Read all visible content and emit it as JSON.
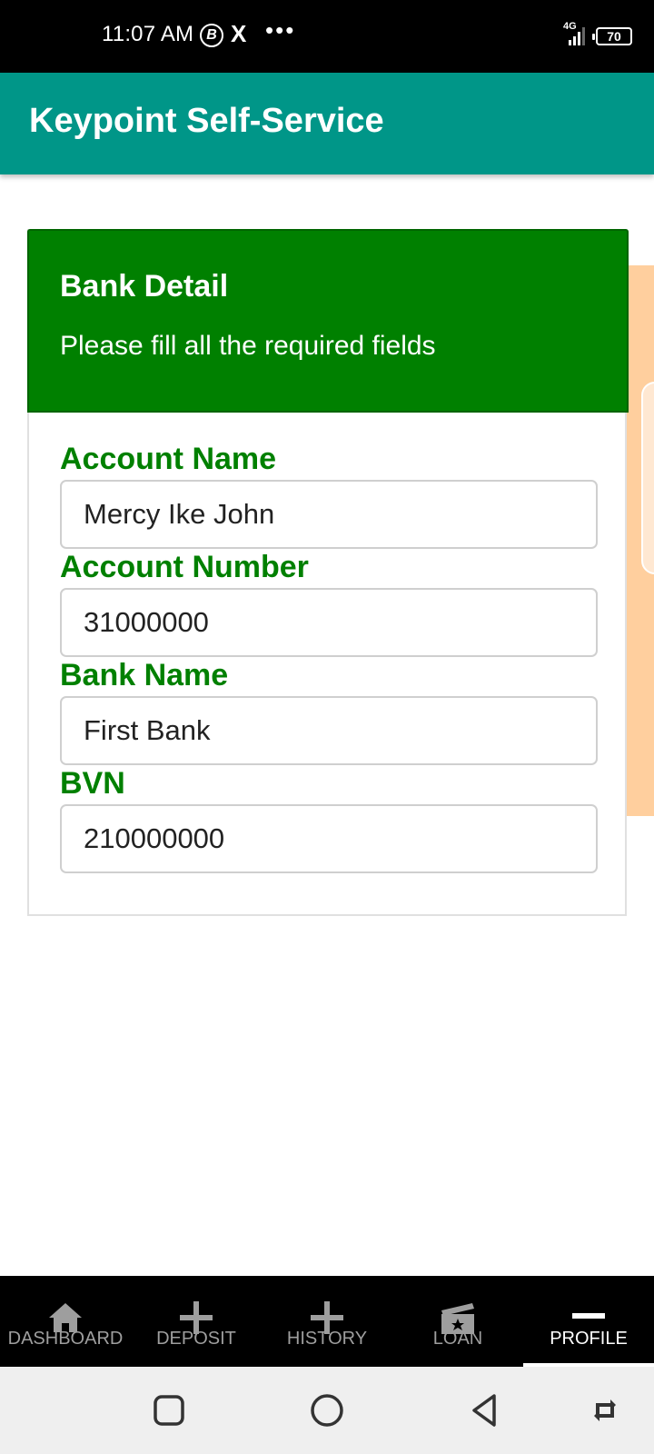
{
  "status_bar": {
    "time": "11:07 AM",
    "network": "4G",
    "battery": "70"
  },
  "app_bar": {
    "title": "Keypoint Self-Service"
  },
  "card": {
    "title": "Bank Detail",
    "subtitle": "Please fill all the required fields",
    "fields": [
      {
        "label": "Account Name",
        "value": "Mercy Ike John"
      },
      {
        "label": "Account Number",
        "value": "31000000"
      },
      {
        "label": "Bank Name",
        "value": "First Bank"
      },
      {
        "label": "BVN",
        "value": "210000000"
      }
    ]
  },
  "bottom_nav": {
    "items": [
      {
        "label": "DASHBOARD",
        "icon": "home-icon"
      },
      {
        "label": "DEPOSIT",
        "icon": "plus-icon"
      },
      {
        "label": "HISTORY",
        "icon": "plus-icon"
      },
      {
        "label": "LOAN",
        "icon": "card-icon"
      },
      {
        "label": "PROFILE",
        "icon": "minus-icon"
      }
    ],
    "active": "PROFILE"
  },
  "colors": {
    "app_bar": "#009688",
    "card_header": "#008000",
    "label": "#008000"
  }
}
